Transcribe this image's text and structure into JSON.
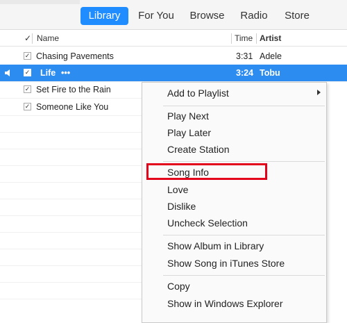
{
  "tabs": [
    {
      "label": "Library",
      "active": true
    },
    {
      "label": "For You"
    },
    {
      "label": "Browse"
    },
    {
      "label": "Radio"
    },
    {
      "label": "Store"
    }
  ],
  "columns": {
    "check": "✓",
    "name": "Name",
    "time": "Time",
    "artist": "Artist"
  },
  "songs": [
    {
      "name": "Chasing Pavements",
      "time": "3:31",
      "artist": "Adele",
      "checked": true
    },
    {
      "name": "Life",
      "dots": "•••",
      "time": "3:24",
      "artist": "Tobu",
      "checked": true,
      "selected": true,
      "playing": true
    },
    {
      "name": "Set Fire to the Rain",
      "checked": true
    },
    {
      "name": "Someone Like You",
      "checked": true
    }
  ],
  "context_menu": {
    "items": [
      "Add to Playlist",
      "Play Next",
      "Play Later",
      "Create Station",
      "Song Info",
      "Love",
      "Dislike",
      "Uncheck Selection",
      "Show Album in Library",
      "Show Song in iTunes Store",
      "Copy",
      "Show in Windows Explorer"
    ],
    "highlighted_item": "Song Info"
  },
  "colors": {
    "accent": "#1f8cff",
    "selection": "#2d8cf0",
    "highlight_box": "#e2001a"
  },
  "icons": {
    "checkmark": "✓",
    "speaker": "speaker-icon",
    "submenu": "chevron-right-icon"
  }
}
